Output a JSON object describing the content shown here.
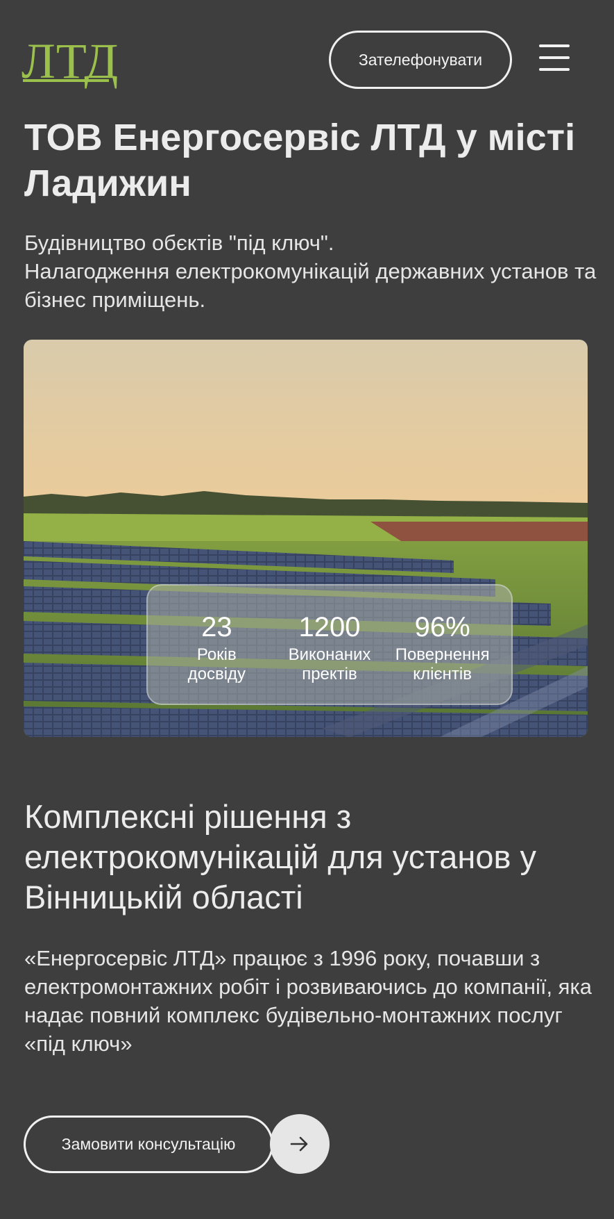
{
  "header": {
    "logo_text": "ЛТД",
    "call_button_label": "Зателефонувати",
    "menu_icon": "hamburger-menu-icon"
  },
  "hero": {
    "title": "ТОВ Енергосервіс ЛТД у місті Ладижин",
    "lead_line1": "Будівництво обєктів \"під ключ\".",
    "lead_line2": "Налагодження електрокомунікацій  державних установ та бізнес приміщень.",
    "stats": [
      {
        "value": "23",
        "label_line1": "Років",
        "label_line2": "досвіду"
      },
      {
        "value": "1200",
        "label_line1": "Виконаних",
        "label_line2": "пректів"
      },
      {
        "value": "96%",
        "label_line1": "Повернення",
        "label_line2": "клієнтів"
      }
    ]
  },
  "about": {
    "title": "Комплексні рішення з електрокомунікацій для установ у Вінницькій області",
    "text": "«Енергосервіс ЛТД» працює з 1996 року, почавши з електромонтажних робіт і розвиваючись до компанії, яка надає повний комплекс будівельно-монтажних послуг «під ключ»",
    "consult_button_label": "Замовити консультацію",
    "arrow_icon": "arrow-right-icon"
  },
  "colors": {
    "background": "#3e3e3e",
    "logo_green": "#9bc04b",
    "text": "#ececec"
  }
}
